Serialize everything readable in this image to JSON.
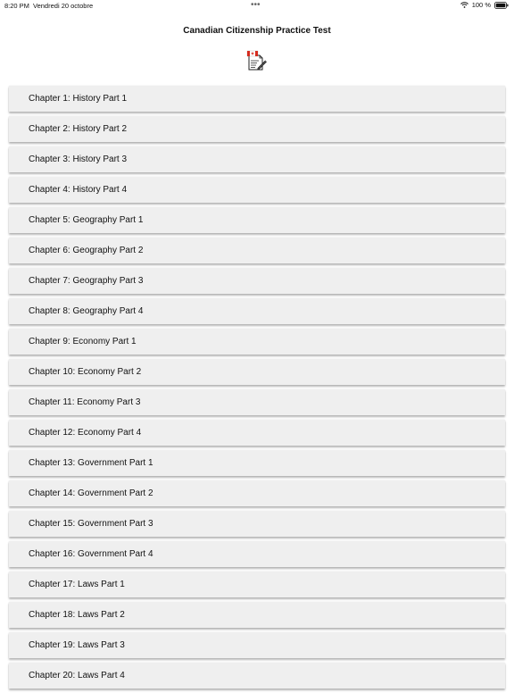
{
  "status_bar": {
    "time": "8:20 PM",
    "date": "Vendredi 20 octobre",
    "dots": "•••",
    "battery_text": "100 %",
    "wifi_icon": "wifi-icon",
    "battery_icon": "battery-icon"
  },
  "header": {
    "title": "Canadian Citizenship Practice Test",
    "icon": "canada-flag-document-icon"
  },
  "chapters": [
    {
      "label": "Chapter 1: History Part 1"
    },
    {
      "label": "Chapter 2: History Part 2"
    },
    {
      "label": "Chapter 3: History Part 3"
    },
    {
      "label": "Chapter 4: History Part 4"
    },
    {
      "label": "Chapter 5: Geography Part 1"
    },
    {
      "label": "Chapter 6: Geography Part 2"
    },
    {
      "label": "Chapter 7: Geography Part 3"
    },
    {
      "label": "Chapter 8: Geography Part 4"
    },
    {
      "label": "Chapter 9: Economy Part 1"
    },
    {
      "label": "Chapter 10: Economy Part 2"
    },
    {
      "label": "Chapter 11: Economy Part 3"
    },
    {
      "label": "Chapter 12: Economy Part 4"
    },
    {
      "label": "Chapter 13: Government Part 1"
    },
    {
      "label": "Chapter 14: Government Part 2"
    },
    {
      "label": "Chapter 15: Government Part 3"
    },
    {
      "label": "Chapter 16: Government Part 4"
    },
    {
      "label": "Chapter 17: Laws Part 1"
    },
    {
      "label": "Chapter 18: Laws Part 2"
    },
    {
      "label": "Chapter 19: Laws Part 3"
    },
    {
      "label": "Chapter 20: Laws Part 4"
    }
  ],
  "colors": {
    "item_background": "#efefef",
    "flag_red": "#d52b1e"
  }
}
